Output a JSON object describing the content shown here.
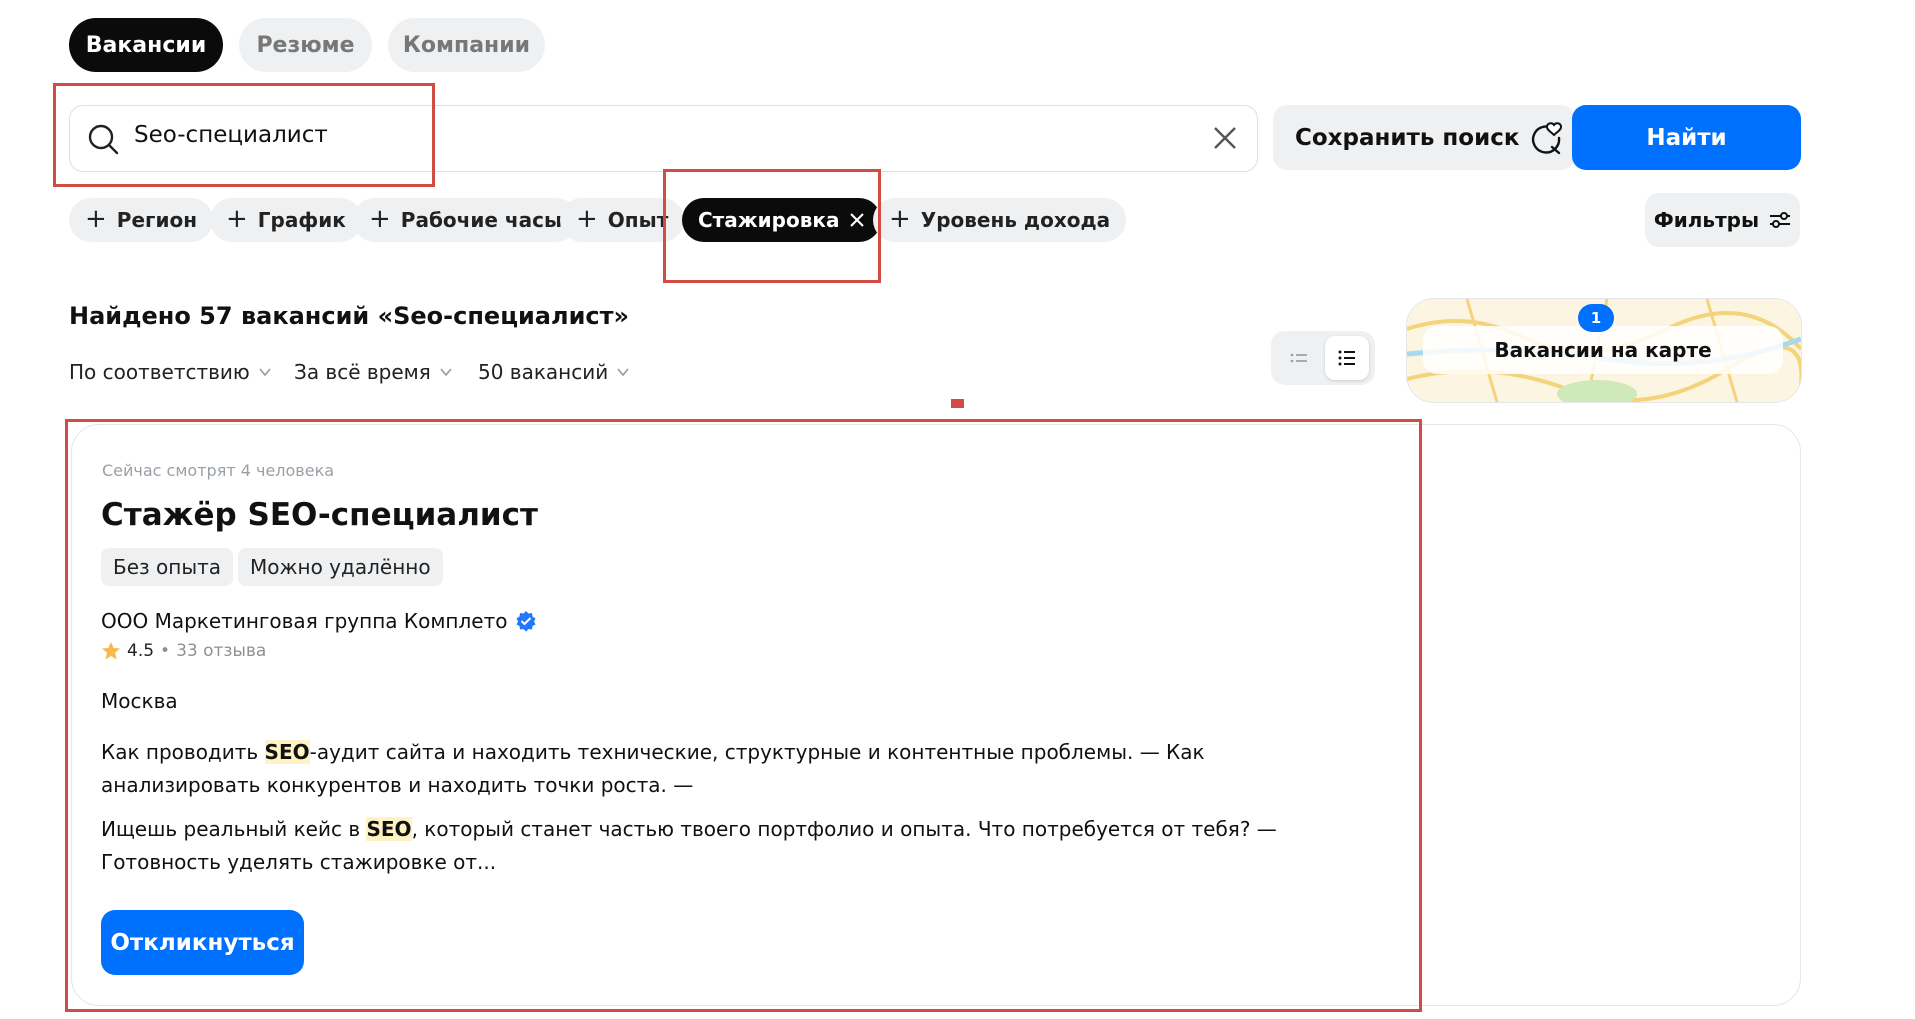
{
  "tabs": [
    {
      "label": "Вакансии",
      "active": true
    },
    {
      "label": "Резюме",
      "active": false
    },
    {
      "label": "Компании",
      "active": false
    }
  ],
  "search": {
    "value": "Seo-специалист",
    "save_label": "Сохранить поиск",
    "find_label": "Найти"
  },
  "chips": [
    {
      "label": "Регион",
      "active": false
    },
    {
      "label": "График",
      "active": false
    },
    {
      "label": "Рабочие часы",
      "active": false
    },
    {
      "label": "Опыт",
      "active": false
    },
    {
      "label": "Стажировка",
      "active": true
    },
    {
      "label": "Уровень дохода",
      "active": false
    }
  ],
  "filters_label": "Фильтры",
  "results": {
    "title": "Найдено 57 вакансий «Seo-специалист»",
    "sort": [
      "По соответствию",
      "За всё время",
      "50 вакансий"
    ]
  },
  "map": {
    "label": "Вакансии на карте",
    "badge": "1"
  },
  "vacancy": {
    "viewers": "Сейчас смотрят 4 человека",
    "title": "Стажёр SEO-специалист",
    "tags": [
      "Без опыта",
      "Можно удалённо"
    ],
    "company": "ООО Маркетинговая группа Комплето",
    "rating": "4.5",
    "reviews": "33 отзыва",
    "city": "Москва",
    "snippet1_pre": "Как проводить ",
    "snippet1_hl": "SEO",
    "snippet1_post": "-аудит сайта и находить технические, структурные и контентные проблемы. — Как анализировать конкурентов и находить точки роста. —",
    "snippet2_pre": "Ищешь реальный кейс в ",
    "snippet2_hl": "SEO",
    "snippet2_post": ", который станет частью твоего портфолио и опыта. Что потребуется от тебя? — Готовность уделять стажировке от...",
    "apply_label": "Откликнуться"
  },
  "colors": {
    "accent": "#0070ff",
    "highlight_frame": "#d24b45"
  }
}
